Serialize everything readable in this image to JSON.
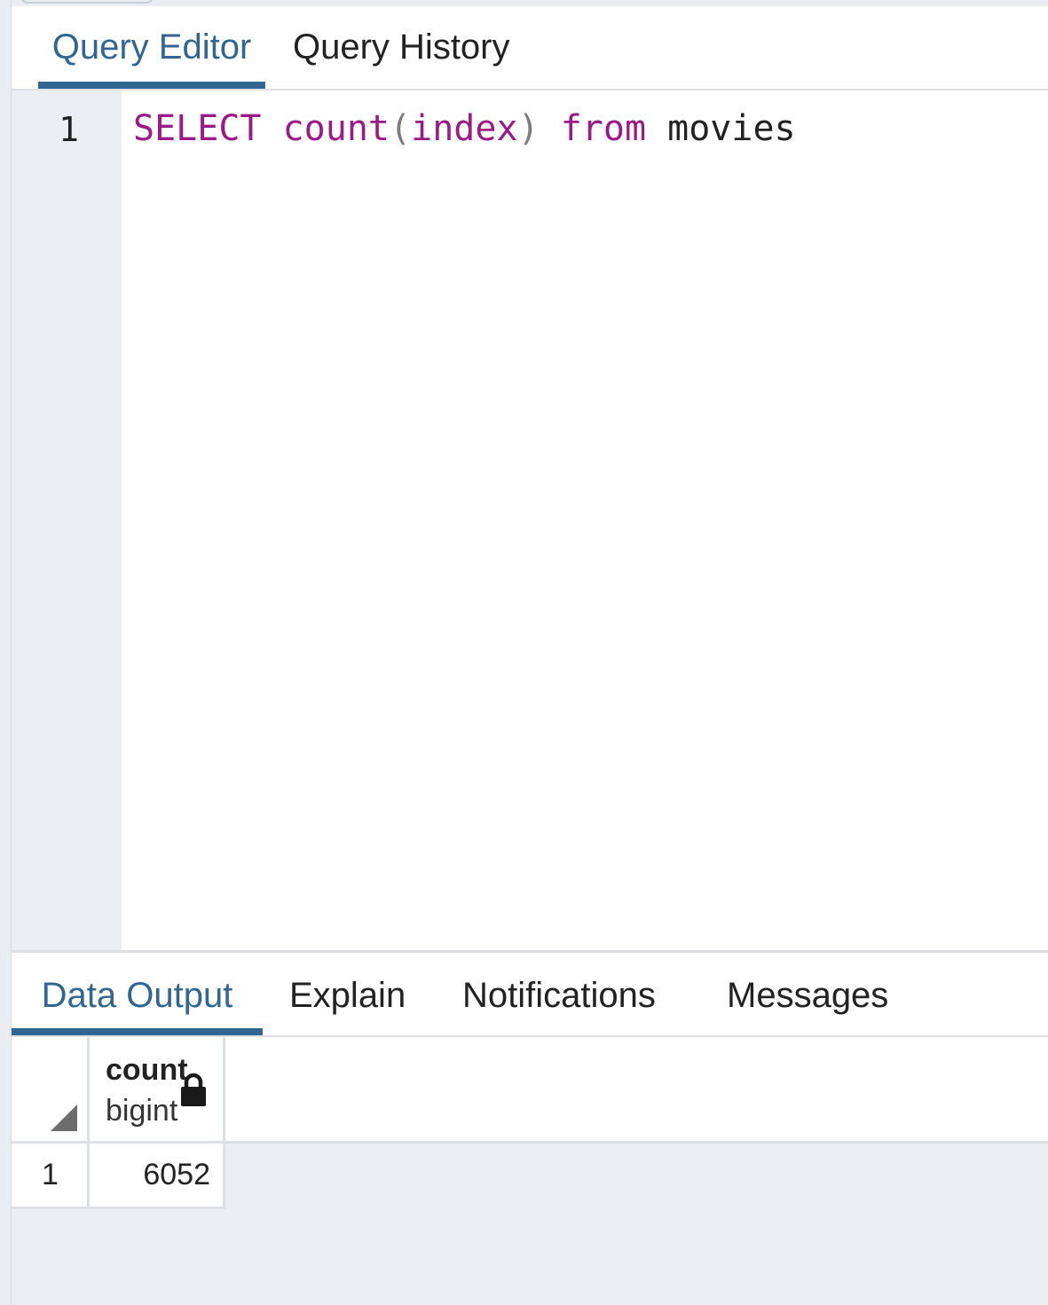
{
  "editor_tabs": [
    "Query Editor",
    "Query History"
  ],
  "active_editor_tab": "Query Editor",
  "editor": {
    "line_number": "1",
    "tokens": {
      "select": "SELECT",
      "count": "count",
      "open_paren": "(",
      "index": "index",
      "close_paren": ")",
      "from": "from",
      "table": "movies"
    }
  },
  "results_tabs": [
    "Data Output",
    "Explain",
    "Notifications",
    "Messages"
  ],
  "active_results_tab": "Data Output",
  "grid": {
    "columns": [
      {
        "name": "count",
        "type": "bigint",
        "icon": "lock-icon"
      }
    ],
    "rows": [
      {
        "row_number": "1",
        "cells": [
          "6052"
        ]
      }
    ]
  },
  "colors": {
    "accent": "#326690",
    "keyword": "#9b1b86",
    "background": "#ebeef2"
  }
}
